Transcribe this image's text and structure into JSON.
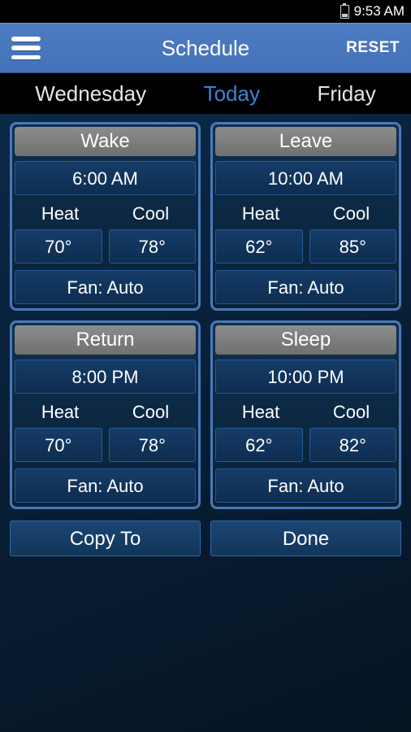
{
  "status": {
    "time": "9:53 AM"
  },
  "toolbar": {
    "title": "Schedule",
    "reset": "RESET"
  },
  "tabs": {
    "prev": "Wednesday",
    "current": "Today",
    "next": "Friday"
  },
  "labels": {
    "heat": "Heat",
    "cool": "Cool"
  },
  "periods": [
    {
      "name": "Wake",
      "time": "6:00 AM",
      "heat": "70°",
      "cool": "78°",
      "fan": "Fan: Auto"
    },
    {
      "name": "Leave",
      "time": "10:00 AM",
      "heat": "62°",
      "cool": "85°",
      "fan": "Fan: Auto"
    },
    {
      "name": "Return",
      "time": "8:00 PM",
      "heat": "70°",
      "cool": "78°",
      "fan": "Fan: Auto"
    },
    {
      "name": "Sleep",
      "time": "10:00 PM",
      "heat": "62°",
      "cool": "82°",
      "fan": "Fan: Auto"
    }
  ],
  "actions": {
    "copy": "Copy To",
    "done": "Done"
  }
}
